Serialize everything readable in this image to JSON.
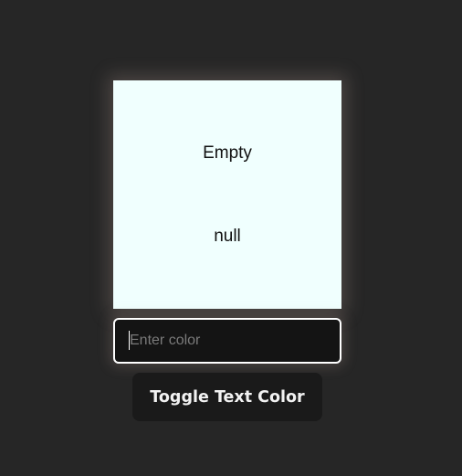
{
  "box": {
    "background_color": "#f0fffe",
    "line1": "Empty",
    "line2": "null"
  },
  "color_input": {
    "value": "",
    "placeholder": "Enter color"
  },
  "toggle_button": {
    "label": "Toggle Text Color"
  },
  "colors": {
    "page_background": "#262626",
    "input_background": "#141414",
    "button_background": "#1a1a1a"
  }
}
